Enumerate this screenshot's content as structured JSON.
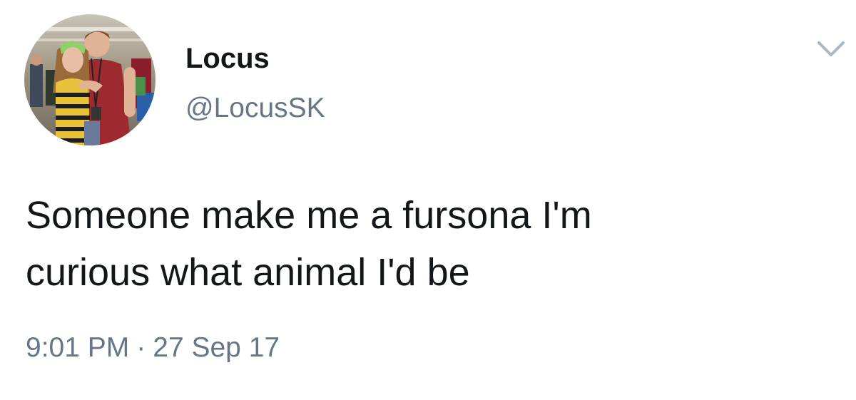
{
  "tweet": {
    "display_name": "Locus",
    "handle": "@LocusSK",
    "text_lines": [
      "Someone make me a fursona I'm",
      "curious what animal I'd be"
    ],
    "time": "9:01 PM",
    "separator": "·",
    "date": "27 Sep 17"
  },
  "icons": {
    "avatar": "profile-photo",
    "menu": "chevron-down-icon"
  },
  "colors": {
    "text_primary": "#14171a",
    "text_secondary": "#657786",
    "chevron": "#aab8c2",
    "background": "#ffffff"
  }
}
